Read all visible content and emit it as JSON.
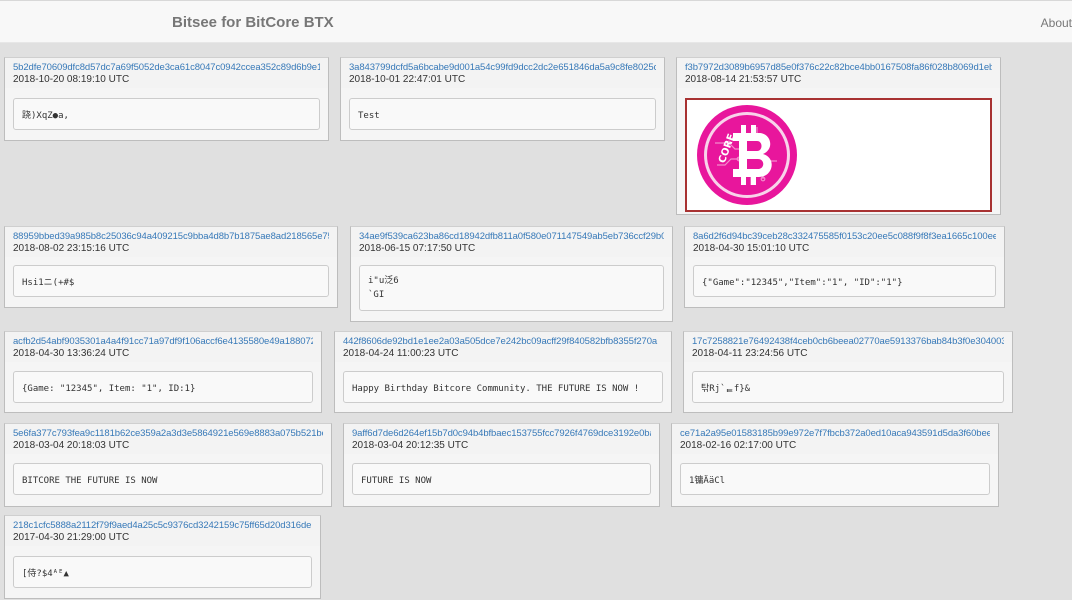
{
  "navbar": {
    "brand": "Bitsee for BitCore BTX",
    "about": "About"
  },
  "cards": [
    {
      "txid": "5b2dfe70609dfc8d57dc7a69f5052de3ca61c8047c0942ccea352c89d6b9e175",
      "time": "2018-10-20 08:19:10 UTC",
      "message": "跷)XqZ●a,"
    },
    {
      "txid": "3a843799dcfd5a6bcabe9d001a54c99fd9dcc2dc2e651846da5a9c8fe8025c53",
      "time": "2018-10-01 22:47:01 UTC",
      "message": "Test"
    },
    {
      "txid": "f3b7972d3089b6957d85e0f376c22c82bce4bb0167508fa86f028b8069d1eb9e",
      "time": "2018-08-14 21:53:57 UTC",
      "message": "",
      "image": "bitcore-logo-icon",
      "logo_color": "#e8169c",
      "logo_text": "CORE"
    },
    {
      "txid": "88959bbed39a985b8c25036c94a409215c9bba4d8b7b1875ae8ad218565e751d",
      "time": "2018-08-02 23:15:16 UTC",
      "message": "Hsi1ニ(+#$"
    },
    {
      "txid": "34ae9f539ca623ba86cd18942dfb811a0f580e071147549ab5eb736ccf29b068",
      "time": "2018-06-15 07:17:50 UTC",
      "message": "i\"u泛6\n`GI"
    },
    {
      "txid": "8a6d2f6d94bc39ceb28c332475585f0153c20ee5c088f9f8f3ea1665c100ee48",
      "time": "2018-04-30 15:01:10 UTC",
      "message": "{\"Game\":\"12345\",\"Item\":\"1\", \"ID\":\"1\"}"
    },
    {
      "txid": "acfb2d54abf9035301a4a4f91cc71a97df9f106accf6e4135580e49a188072b4",
      "time": "2018-04-30 13:36:24 UTC",
      "message": "{Game: \"12345\", Item: \"1\", ID:1}"
    },
    {
      "txid": "442f8606de92bd1e1ee2a03a505dce7e242bc09acff29f840582bfb8355f270a",
      "time": "2018-04-24 11:00:23 UTC",
      "message": "Happy Birthday Bitcore Community. THE FUTURE IS NOW !"
    },
    {
      "txid": "17c7258821e76492438f4ceb0cb6beea02770ae5913376bab84b3f0e3040034e",
      "time": "2018-04-11 23:24:56 UTC",
      "message": "탂Rj`ᇀf}&"
    },
    {
      "txid": "5e6fa377c793fea9c1181b62ce359a2a3d3e5864921e569e8883a075b521bcc8",
      "time": "2018-03-04 20:18:03 UTC",
      "message": "BITCORE THE FUTURE IS NOW"
    },
    {
      "txid": "9aff6d7de6d264ef15b7d0c94b4bfbaec153755fcc7926f4769dce3192e0ba8f",
      "time": "2018-03-04 20:12:35 UTC",
      "message": "FUTURE IS NOW"
    },
    {
      "txid": "ce71a2a95e01583185b99e972e7f7fbcb372a0ed10aca943591d5da3f60beeb1",
      "time": "2018-02-16 02:17:00 UTC",
      "message": "1镛ÄäCl"
    },
    {
      "txid": "218c1cfc5888a2112f79f9aed4a25c5c9376cd3242159c75ff65d20d316de14f",
      "time": "2017-04-30 21:29:00 UTC",
      "message": "[侍?$4ᴬᴱ▲"
    }
  ]
}
